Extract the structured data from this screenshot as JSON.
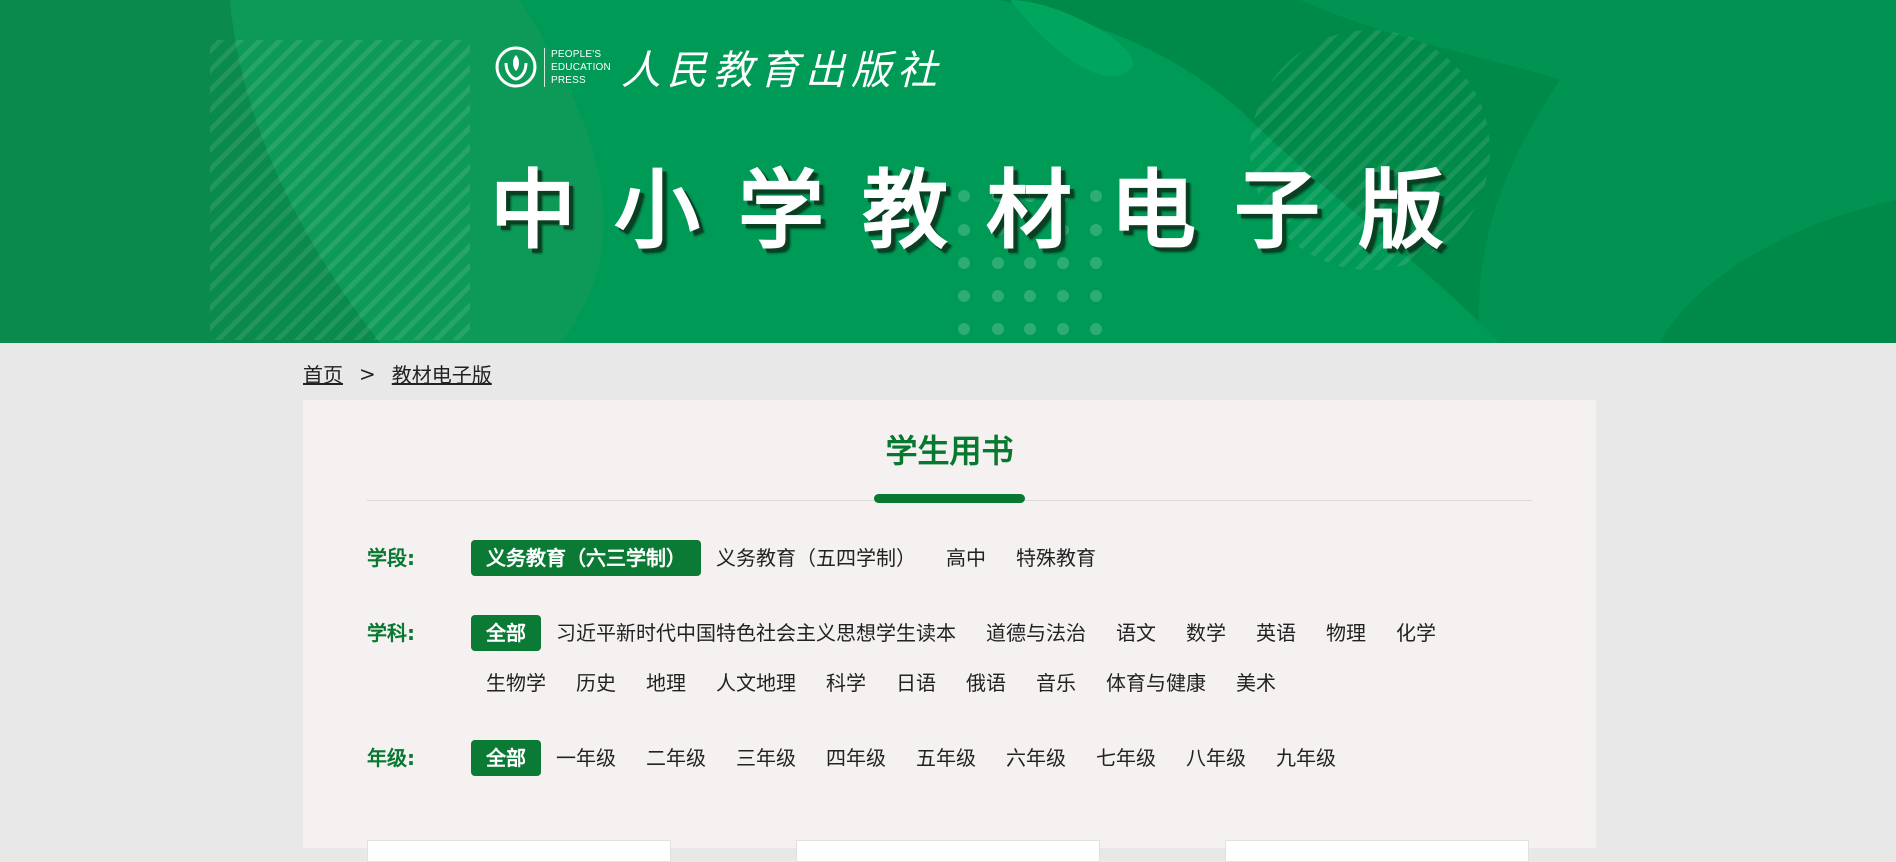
{
  "banner": {
    "logo_en_lines": [
      "PEOPLE'S",
      "EDUCATION",
      "PRESS"
    ],
    "logo_cn": "人民教育出版社",
    "title": "中小学教材电子版"
  },
  "breadcrumb": {
    "home": "首页",
    "separator": ">",
    "current": "教材电子版"
  },
  "section": {
    "title": "学生用书"
  },
  "filters": {
    "stage": {
      "label": "学段:",
      "options": [
        "义务教育（六三学制）",
        "义务教育（五四学制）",
        "高中",
        "特殊教育"
      ],
      "selected": "义务教育（六三学制）"
    },
    "subject": {
      "label": "学科:",
      "options": [
        "全部",
        "习近平新时代中国特色社会主义思想学生读本",
        "道德与法治",
        "语文",
        "数学",
        "英语",
        "物理",
        "化学",
        "生物学",
        "历史",
        "地理",
        "人文地理",
        "科学",
        "日语",
        "俄语",
        "音乐",
        "体育与健康",
        "美术"
      ],
      "selected": "全部"
    },
    "grade": {
      "label": "年级:",
      "options": [
        "全部",
        "一年级",
        "二年级",
        "三年级",
        "四年级",
        "五年级",
        "六年级",
        "七年级",
        "八年级",
        "九年级"
      ],
      "selected": "全部"
    }
  },
  "colors": {
    "brand_green": "#07782f",
    "banner_green": "#009a57",
    "page_bg": "#e8e8e8",
    "panel_bg": "#f4f1f0"
  }
}
